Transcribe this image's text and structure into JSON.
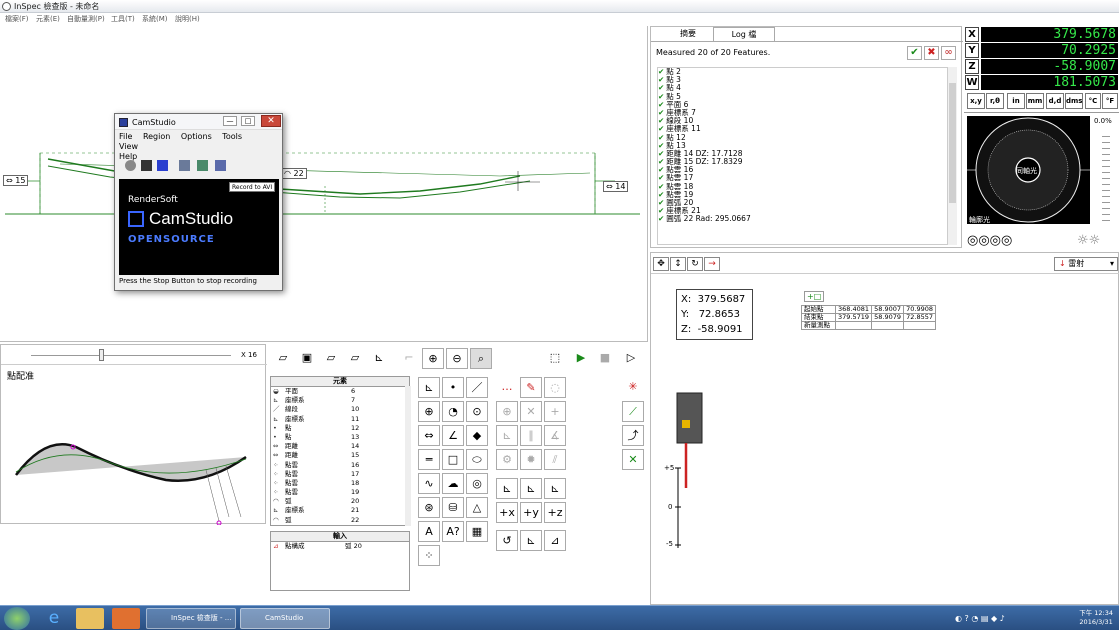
{
  "app": {
    "title": "InSpec 檢查版 - 未命名",
    "menu": [
      "檔案(F)",
      "元素(E)",
      "自動量測(P)",
      "工具(T)",
      "系統(M)",
      "說明(H)"
    ]
  },
  "canvas": {
    "labels": [
      {
        "text": "15",
        "icon": "distance-icon"
      },
      {
        "text": "22",
        "icon": "arc-icon"
      },
      {
        "text": "14",
        "icon": "distance-icon"
      }
    ]
  },
  "camstudio": {
    "title": "CamStudio",
    "menu": [
      "File",
      "Region",
      "Options",
      "Tools",
      "View",
      "Help"
    ],
    "tooltip": "Record to AVI",
    "banner_vendor": "RenderSoft",
    "banner_name": "CamStudio",
    "banner_open": "OPENSOURCE",
    "status": "Press the Stop Button to stop recording",
    "window_buttons": [
      "minimize",
      "maximize",
      "close"
    ]
  },
  "log": {
    "tabs": [
      "摘要",
      "Log 檔"
    ],
    "active_tab": 1,
    "measured": "Measured 20 of 20 Features.",
    "items": [
      {
        "name": "點 2",
        "extra": ""
      },
      {
        "name": "點 3",
        "extra": ""
      },
      {
        "name": "點 4",
        "extra": ""
      },
      {
        "name": "點 5",
        "extra": ""
      },
      {
        "name": "平面 6",
        "extra": ""
      },
      {
        "name": "座標系 7",
        "extra": ""
      },
      {
        "name": "線段 10",
        "extra": ""
      },
      {
        "name": "座標系 11",
        "extra": ""
      },
      {
        "name": "點 12",
        "extra": ""
      },
      {
        "name": "點 13",
        "extra": ""
      },
      {
        "name": "距離 14",
        "extra": "DZ: 17.7128"
      },
      {
        "name": "距離 15",
        "extra": "DZ: 17.8329"
      },
      {
        "name": "點雲 16",
        "extra": ""
      },
      {
        "name": "點雲 17",
        "extra": ""
      },
      {
        "name": "點雲 18",
        "extra": ""
      },
      {
        "name": "點雲 19",
        "extra": ""
      },
      {
        "name": "圓弧 20",
        "extra": ""
      },
      {
        "name": "座標系 21",
        "extra": ""
      },
      {
        "name": "圓弧 22",
        "extra": "Rad: 295.0667"
      }
    ]
  },
  "coords": {
    "X": "379.5678",
    "Y": "70.2925",
    "Z": "-58.9007",
    "W": "181.5073",
    "units": [
      "x,y",
      "r,θ",
      "in",
      "mm",
      "d,d",
      "dms",
      "°C",
      "°F"
    ],
    "percent": "0.0%",
    "dial_center": "同軸光",
    "dial_label": "輪廓光"
  },
  "probe": {
    "mode": "雷射",
    "readout": {
      "X": "379.5687",
      "Y": "72.8653",
      "Z": "-58.9091"
    },
    "table": [
      [
        "起始點",
        "368.4081",
        "58.9007",
        "70.9908"
      ],
      [
        "結束點",
        "379.5719",
        "58.9079",
        "72.8557"
      ],
      [
        "新量測點",
        "",
        "",
        ""
      ]
    ],
    "scale": [
      "+5",
      "0",
      "-5"
    ]
  },
  "pointpane": {
    "zoom": "X 16",
    "title": "點配准"
  },
  "elements": {
    "header": "元素",
    "rows": [
      {
        "icon": "◒",
        "name": "平面",
        "id": "6"
      },
      {
        "icon": "⊾",
        "name": "座標系",
        "id": "7"
      },
      {
        "icon": "／",
        "name": "線段",
        "id": "10"
      },
      {
        "icon": "⊾",
        "name": "座標系",
        "id": "11"
      },
      {
        "icon": "•",
        "name": "點",
        "id": "12"
      },
      {
        "icon": "•",
        "name": "點",
        "id": "13"
      },
      {
        "icon": "⇔",
        "name": "距離",
        "id": "14"
      },
      {
        "icon": "⇔",
        "name": "距離",
        "id": "15"
      },
      {
        "icon": "⁘",
        "name": "點雲",
        "id": "16"
      },
      {
        "icon": "⁘",
        "name": "點雲",
        "id": "17"
      },
      {
        "icon": "⁘",
        "name": "點雲",
        "id": "18"
      },
      {
        "icon": "⁘",
        "name": "點雲",
        "id": "19"
      },
      {
        "icon": "◠",
        "name": "弧",
        "id": "20"
      },
      {
        "icon": "⊾",
        "name": "座標系",
        "id": "21"
      },
      {
        "icon": "◠",
        "name": "弧",
        "id": "22"
      }
    ],
    "input_header": "輸入",
    "input_rows": [
      {
        "left": "點構成",
        "right": "弧 20"
      }
    ]
  },
  "taskbar": {
    "items": [
      "InSpec 檢查版 - ...",
      "CamStudio"
    ],
    "time": "下午 12:34",
    "date": "2016/3/31"
  }
}
